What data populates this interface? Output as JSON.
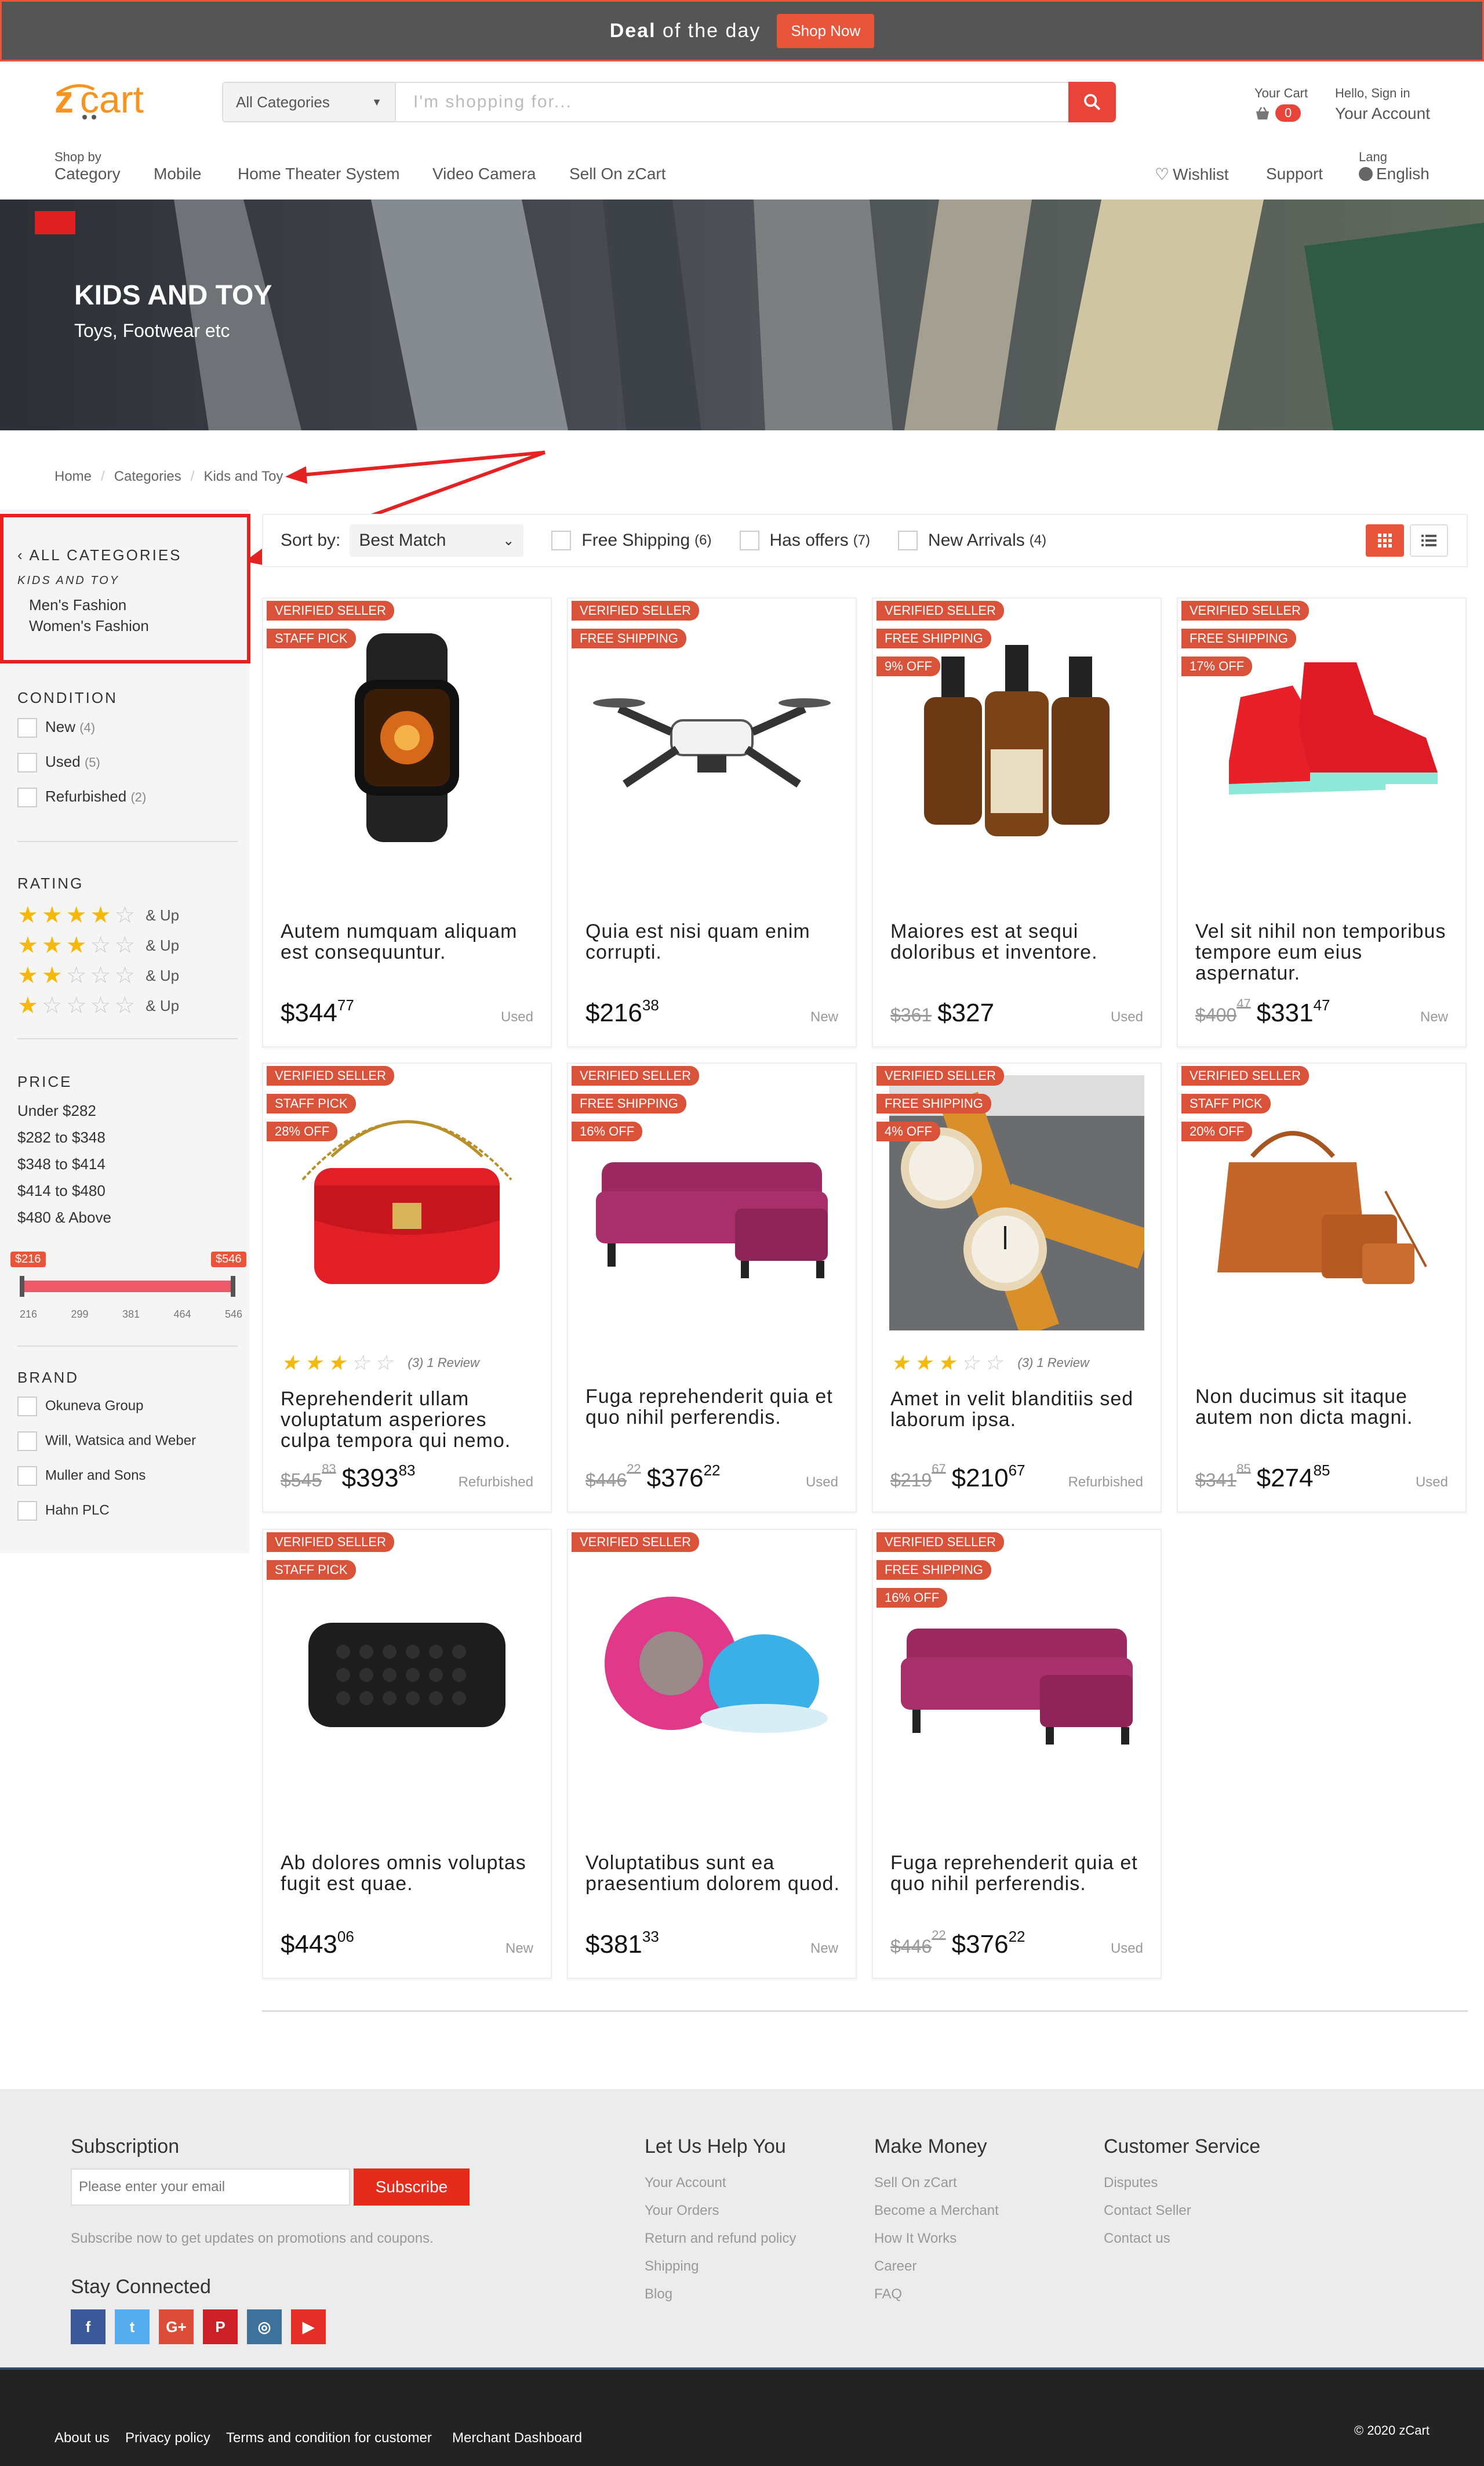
{
  "topbar": {
    "deal_bold": "Deal",
    "deal_rest": "of the day",
    "shop_now": "Shop Now"
  },
  "header": {
    "logo_text": "zcart",
    "category_select": "All Categories",
    "search_placeholder": "I'm shopping for...",
    "cart_label": "Your Cart",
    "cart_count": "0",
    "greeting": "Hello, Sign in",
    "account": "Your Account"
  },
  "nav": {
    "shop_by": "Shop by",
    "category": "Category",
    "items": [
      "Mobile",
      "Home Theater System",
      "Video Camera",
      "Sell On zCart"
    ],
    "wishlist": "Wishlist",
    "support": "Support",
    "lang_label": "Lang",
    "language": "English"
  },
  "hero": {
    "title": "KIDS AND TOY",
    "subtitle": "Toys, Footwear etc"
  },
  "breadcrumb": [
    "Home",
    "Categories",
    "Kids and Toy"
  ],
  "sidebar": {
    "all_categories": "ALL CATEGORIES",
    "current": "KIDS AND TOY",
    "subcategories": [
      "Men's Fashion",
      "Women's Fashion"
    ],
    "condition_title": "CONDITION",
    "conditions": [
      {
        "label": "New",
        "count": "(4)"
      },
      {
        "label": "Used",
        "count": "(5)"
      },
      {
        "label": "Refurbished",
        "count": "(2)"
      }
    ],
    "rating_title": "RATING",
    "rating_suffix": "& Up",
    "ratings": [
      4,
      3,
      2,
      1
    ],
    "price_title": "PRICE",
    "price_ranges": [
      "Under $282",
      "$282 to $348",
      "$348 to $414",
      "$414 to $480",
      "$480 & Above"
    ],
    "slider": {
      "min_label": "$216",
      "max_label": "$546",
      "ticks": [
        "216",
        "299",
        "381",
        "464",
        "546"
      ]
    },
    "brand_title": "BRAND",
    "brands": [
      "Okuneva Group",
      "Will, Watsica and Weber",
      "Muller and Sons",
      "Hahn PLC"
    ]
  },
  "filterbar": {
    "sort_label": "Sort by:",
    "sort_value": "Best Match",
    "filters": [
      {
        "label": "Free Shipping",
        "count": "(6)"
      },
      {
        "label": "Has offers",
        "count": "(7)"
      },
      {
        "label": "New Arrivals",
        "count": "(4)"
      }
    ]
  },
  "products": [
    {
      "badges": [
        "VERIFIED SELLER",
        "STAFF PICK"
      ],
      "title": "Autem numquam aliquam est consequuntur.",
      "old": "",
      "old_c": "",
      "price": "$344",
      "cents": "77",
      "cond": "Used",
      "icon": "smartwatch",
      "rating": ""
    },
    {
      "badges": [
        "VERIFIED SELLER",
        "FREE SHIPPING"
      ],
      "title": "Quia est nisi quam enim corrupti.",
      "old": "",
      "old_c": "",
      "price": "$216",
      "cents": "38",
      "cond": "New",
      "icon": "drone",
      "rating": ""
    },
    {
      "badges": [
        "VERIFIED SELLER",
        "FREE SHIPPING",
        "9% OFF"
      ],
      "title": "Maiores est at sequi doloribus et inventore.",
      "old": "$361",
      "old_c": "",
      "price": "$327",
      "cents": "",
      "cond": "Used",
      "icon": "bottles",
      "rating": ""
    },
    {
      "badges": [
        "VERIFIED SELLER",
        "FREE SHIPPING",
        "17% OFF"
      ],
      "title": "Vel sit nihil non temporibus tempore eum eius aspernatur.",
      "old": "$400",
      "old_c": "47",
      "price": "$331",
      "cents": "47",
      "cond": "New",
      "icon": "sneakers",
      "rating": ""
    },
    {
      "badges": [
        "VERIFIED SELLER",
        "STAFF PICK",
        "28% OFF"
      ],
      "title": "Reprehenderit ullam voluptatum asperiores culpa tempora qui nemo.",
      "old": "$545",
      "old_c": "83",
      "price": "$393",
      "cents": "83",
      "cond": "Refurbished",
      "icon": "handbag",
      "rating": "(3) 1 Review"
    },
    {
      "badges": [
        "VERIFIED SELLER",
        "FREE SHIPPING",
        "16% OFF"
      ],
      "title": "Fuga reprehenderit quia et quo nihil perferendis.",
      "old": "$446",
      "old_c": "22",
      "price": "$376",
      "cents": "22",
      "cond": "Used",
      "icon": "sofa",
      "rating": ""
    },
    {
      "badges": [
        "VERIFIED SELLER",
        "FREE SHIPPING",
        "4% OFF"
      ],
      "title": "Amet in velit blanditiis sed laborum ipsa.",
      "old": "$219",
      "old_c": "67",
      "price": "$210",
      "cents": "67",
      "cond": "Refurbished",
      "icon": "watches",
      "rating": "(3) 1 Review"
    },
    {
      "badges": [
        "VERIFIED SELLER",
        "STAFF PICK",
        "20% OFF"
      ],
      "title": "Non ducimus sit itaque autem non dicta magni.",
      "old": "$341",
      "old_c": "85",
      "price": "$274",
      "cents": "85",
      "cond": "Used",
      "icon": "bags",
      "rating": ""
    },
    {
      "badges": [
        "VERIFIED SELLER",
        "STAFF PICK"
      ],
      "title": "Ab dolores omnis voluptas fugit est quae.",
      "old": "",
      "old_c": "",
      "price": "$443",
      "cents": "06",
      "cond": "New",
      "icon": "speaker",
      "rating": ""
    },
    {
      "badges": [
        "VERIFIED SELLER"
      ],
      "title": "Voluptatibus sunt ea praesentium dolorem quod.",
      "old": "",
      "old_c": "",
      "price": "$381",
      "cents": "33",
      "cond": "New",
      "icon": "shower-speakers",
      "rating": ""
    },
    {
      "badges": [
        "VERIFIED SELLER",
        "FREE SHIPPING",
        "16% OFF"
      ],
      "title": "Fuga reprehenderit quia et quo nihil perferendis.",
      "old": "$446",
      "old_c": "22",
      "price": "$376",
      "cents": "22",
      "cond": "Used",
      "icon": "sofa",
      "rating": ""
    }
  ],
  "footer": {
    "subscription_title": "Subscription",
    "email_placeholder": "Please enter your email",
    "subscribe": "Subscribe",
    "subscribe_note": "Subscribe now to get updates on promotions and coupons.",
    "stay_connected": "Stay Connected",
    "social": [
      {
        "name": "facebook-icon",
        "glyph": "f",
        "color": "#3b5998"
      },
      {
        "name": "twitter-icon",
        "glyph": "t",
        "color": "#55acee"
      },
      {
        "name": "google-plus-icon",
        "glyph": "G+",
        "color": "#dd4b39"
      },
      {
        "name": "pinterest-icon",
        "glyph": "P",
        "color": "#cb2027"
      },
      {
        "name": "instagram-icon",
        "glyph": "◎",
        "color": "#3f729b"
      },
      {
        "name": "youtube-icon",
        "glyph": "▶",
        "color": "#e52d27"
      }
    ],
    "columns": [
      {
        "title": "Let Us Help You",
        "links": [
          "Your Account",
          "Your Orders",
          "Return and refund policy",
          "Shipping",
          "Blog"
        ]
      },
      {
        "title": "Make Money",
        "links": [
          "Sell On zCart",
          "Become a Merchant",
          "How It Works",
          "Career",
          "FAQ"
        ]
      },
      {
        "title": "Customer Service",
        "links": [
          "Disputes",
          "Contact Seller",
          "Contact us"
        ]
      }
    ],
    "bottom_links": [
      "About us",
      "Privacy policy",
      "Terms and condition for customer",
      "Merchant Dashboard"
    ],
    "copyright": "© 2020 zCart"
  },
  "colors": {
    "accent": "#e8553a",
    "brand_orange": "#f7931e",
    "annotation_red": "#e52222"
  }
}
